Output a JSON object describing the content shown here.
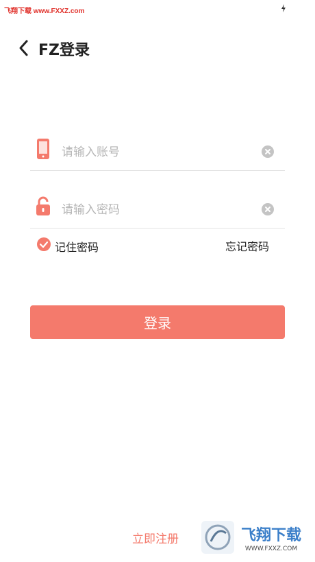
{
  "status_bar": {
    "watermark": "飞翔下载 www.FXXZ.com"
  },
  "header": {
    "title": "FZ登录"
  },
  "form": {
    "account": {
      "placeholder": "请输入账号",
      "value": ""
    },
    "password": {
      "placeholder": "请输入密码",
      "value": ""
    },
    "remember_label": "记住密码",
    "remember_checked": true,
    "forgot_label": "忘记密码",
    "login_label": "登录"
  },
  "footer": {
    "register_label": "立即注册",
    "logo_text": "飞翔下载",
    "logo_url": "WWW.FXXZ.COM"
  },
  "colors": {
    "accent": "#f47a6c",
    "clear_icon": "#c4c4c4",
    "divider": "#e3e3e3"
  },
  "icons": [
    "back-arrow-icon",
    "phone-icon",
    "lock-icon",
    "clear-icon",
    "check-icon",
    "lightning-icon"
  ]
}
